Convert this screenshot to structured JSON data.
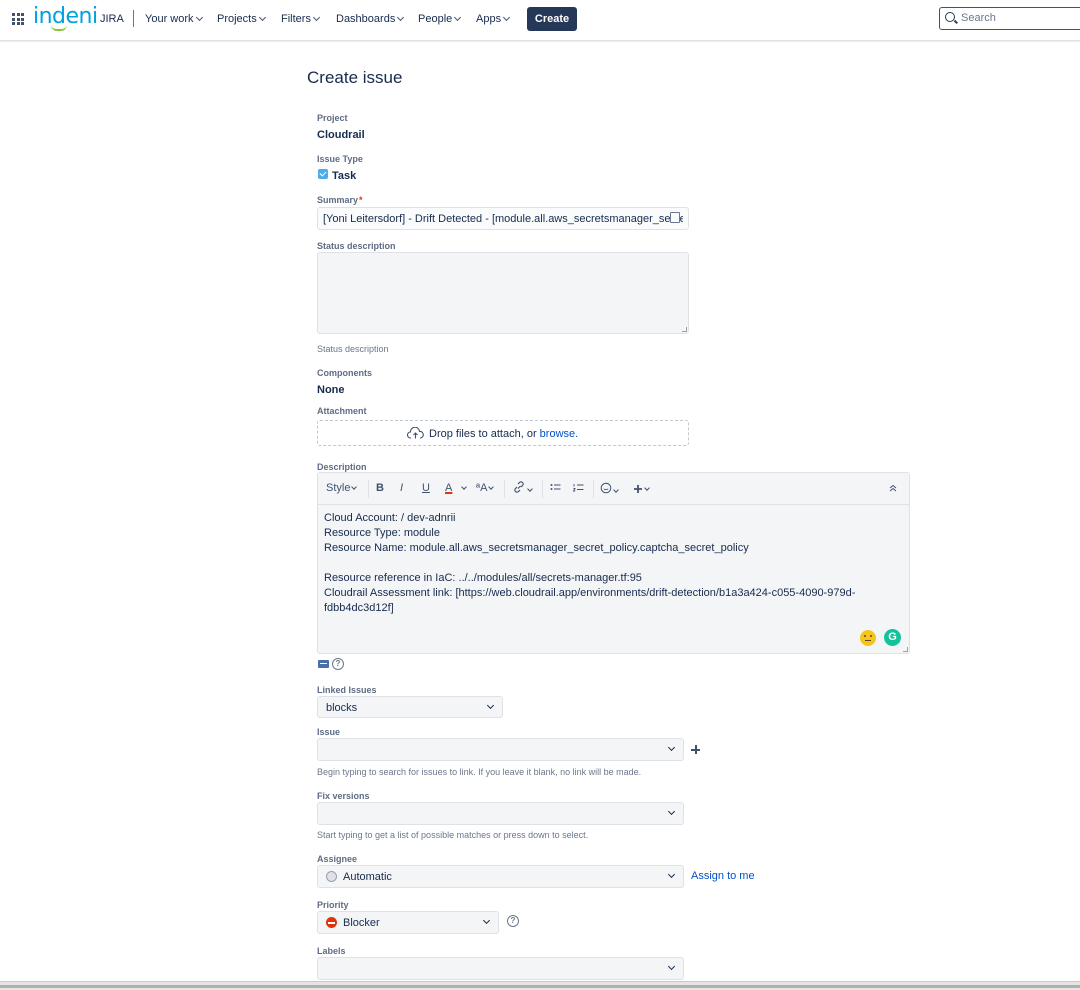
{
  "nav": {
    "logo": "indeni",
    "product": "JIRA",
    "items": [
      {
        "label": "Your work"
      },
      {
        "label": "Projects"
      },
      {
        "label": "Filters"
      },
      {
        "label": "Dashboards"
      },
      {
        "label": "People"
      },
      {
        "label": "Apps"
      }
    ],
    "create_label": "Create",
    "search_placeholder": "Search"
  },
  "form": {
    "title": "Create issue",
    "project": {
      "label": "Project",
      "value": "Cloudrail"
    },
    "issue_type": {
      "label": "Issue Type",
      "value": "Task"
    },
    "summary": {
      "label": "Summary",
      "required_mark": "*",
      "value": "[Yoni Leitersdorf] - Drift Detected - [module.all.aws_secretsmanager_secret_policy.captcha_secret_policy]"
    },
    "status_description": {
      "label": "Status description",
      "value": "",
      "help": "Status description"
    },
    "components": {
      "label": "Components",
      "value": "None"
    },
    "attachment": {
      "label": "Attachment",
      "drop_text": "Drop files to attach, or ",
      "browse_label": "browse."
    },
    "description": {
      "label": "Description",
      "toolbar": {
        "style": "Style",
        "bold": "B",
        "italic": "I",
        "underline": "U",
        "text_color": "A",
        "text_effects": "ªA"
      },
      "lines": [
        "Cloud Account:  / dev-adnrii",
        "Resource Type: module",
        "Resource Name: module.all.aws_secretsmanager_secret_policy.captcha_secret_policy",
        "",
        "Resource reference in IaC: ../../modules/all/secrets-manager.tf:95",
        "Cloudrail Assessment link: [https://web.cloudrail.app/environments/drift-detection/b1a3a424-c055-4090-979d-fdbb4dc3d12f]"
      ]
    },
    "linked_issues": {
      "label": "Linked Issues",
      "value": "blocks"
    },
    "issue": {
      "label": "Issue",
      "value": "",
      "help": "Begin typing to search for issues to link. If you leave it blank, no link will be made."
    },
    "fix_versions": {
      "label": "Fix versions",
      "value": "",
      "help": "Start typing to get a list of possible matches or press down to select."
    },
    "assignee": {
      "label": "Assignee",
      "value": "Automatic",
      "assign_to_me": "Assign to me"
    },
    "priority": {
      "label": "Priority",
      "value": "Blocker",
      "color": "#de350b"
    },
    "labels": {
      "label": "Labels",
      "value": ""
    }
  },
  "colors": {
    "accent": "#0052cc",
    "create_button": "#253858",
    "logo": "#00a1e0"
  }
}
